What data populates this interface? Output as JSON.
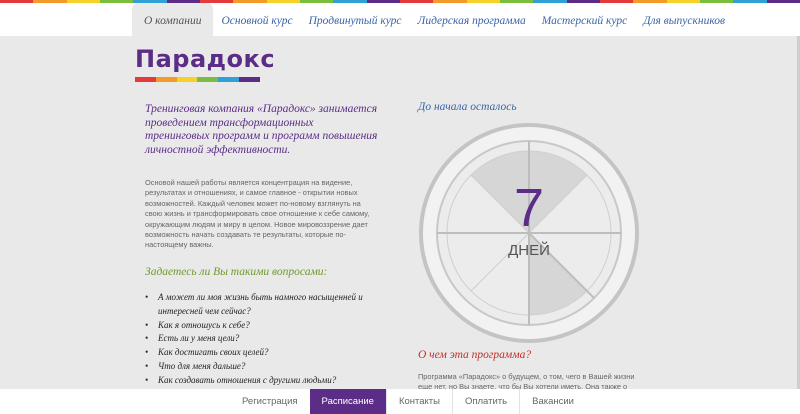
{
  "rainbow_colors": [
    "#e53a3a",
    "#f29b2b",
    "#f5d12a",
    "#7bbd3d",
    "#2fa0d8",
    "#5b2d86",
    "#e53a3a",
    "#f29b2b",
    "#f5d12a",
    "#7bbd3d",
    "#2fa0d8",
    "#5b2d86",
    "#e53a3a",
    "#f29b2b",
    "#f5d12a",
    "#7bbd3d",
    "#2fa0d8",
    "#5b2d86",
    "#e53a3a",
    "#f29b2b",
    "#f5d12a",
    "#7bbd3d",
    "#2fa0d8",
    "#5b2d86"
  ],
  "nav": {
    "items": [
      {
        "label": "О компании"
      },
      {
        "label": "Основной курс"
      },
      {
        "label": "Продвинутый курс"
      },
      {
        "label": "Лидерская программа"
      },
      {
        "label": "Мастерский курс"
      },
      {
        "label": "Для выпускников"
      }
    ],
    "active_index": 0
  },
  "logo": {
    "text": "Парадокс",
    "bar_colors": [
      "#e53a3a",
      "#f29b2b",
      "#f5d12a",
      "#7bbd3d",
      "#2fa0d8",
      "#5b2d86"
    ]
  },
  "intro": "Тренинговая компания «Парадокс» занимается проведением трансформационных тренинговых программ и программ повышения личностной эффективности.",
  "body": "Основой нашей работы является концентрация на видение, результатах и отношениях, и самое главное - открытии новых возможностей. Каждый человек может по-новому взглянуть на свою жизнь и трансформировать свое отношение к себе самому, окружающим людям и миру в целом. Новое мировоззрение дает возможность начать создавать те результаты, которые по-настоящему важны.",
  "questions": {
    "heading": "Задаетесь ли Вы такими вопросами:",
    "items": [
      "А может ли моя жизнь быть намного насыщенней и интересней чем сейчас?",
      "Как я отношусь к себе?",
      "Есть ли у меня цели?",
      "Как достигать своих целей?",
      "Что для меня дальше?",
      "Как создавать отношения с другими людьми?"
    ]
  },
  "countdown": {
    "title": "До начала осталось",
    "number": "7",
    "unit": "ДНЕЙ",
    "segments_total": 8,
    "segments_filled": 3
  },
  "about": {
    "heading": "О чем эта программа?",
    "text": "Программа «Парадокс» о будущем, о том, чего в Вашей жизни еще нет, но Вы знаете, что бы Вы хотели иметь. Она также о"
  },
  "bottom_nav": {
    "items": [
      {
        "label": "Регистрация"
      },
      {
        "label": "Расписание"
      },
      {
        "label": "Контакты"
      },
      {
        "label": "Оплатить"
      },
      {
        "label": "Вакансии"
      }
    ],
    "active_index": 1
  },
  "colors": {
    "purple": "#5b2d86",
    "green": "#6f9a2c",
    "red": "#c1302b",
    "blue": "#3a64a8"
  }
}
